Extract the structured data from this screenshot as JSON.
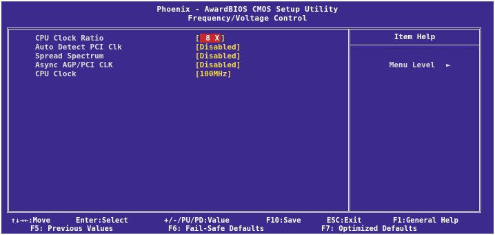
{
  "header": {
    "title": "Phoenix - AwardBIOS CMOS Setup Utility",
    "subtitle": "Frequency/Voltage Control"
  },
  "settings": [
    {
      "label": "CPU Clock Ratio",
      "value_open": "[",
      "value": " 8 X",
      "value_close": "]",
      "highlighted": true
    },
    {
      "label": "Auto Detect PCI Clk",
      "value": "[Disabled]",
      "highlighted": false
    },
    {
      "label": "Spread Spectrum",
      "value": "[Disabled]",
      "highlighted": false
    },
    {
      "label": "Async AGP/PCI CLK",
      "value": "[Disabled]",
      "highlighted": false
    },
    {
      "label": "CPU Clock",
      "value": "[100MHz]",
      "highlighted": false
    }
  ],
  "help": {
    "title": "Item Help",
    "menu_level_label": "Menu Level",
    "menu_level_arrow": "►"
  },
  "footer": {
    "line1": [
      "↑↓→←:Move",
      "Enter:Select",
      "+/-/PU/PD:Value",
      "F10:Save",
      "ESC:Exit",
      "F1:General Help"
    ],
    "line2": [
      "F5: Previous Values",
      "F6: Fail-Safe Defaults",
      "F7: Optimized Defaults"
    ]
  },
  "colors": {
    "background": "#3c2a8c",
    "text": "#dcdcdc",
    "value": "#f2d84a",
    "highlight": "#c62a2a"
  }
}
